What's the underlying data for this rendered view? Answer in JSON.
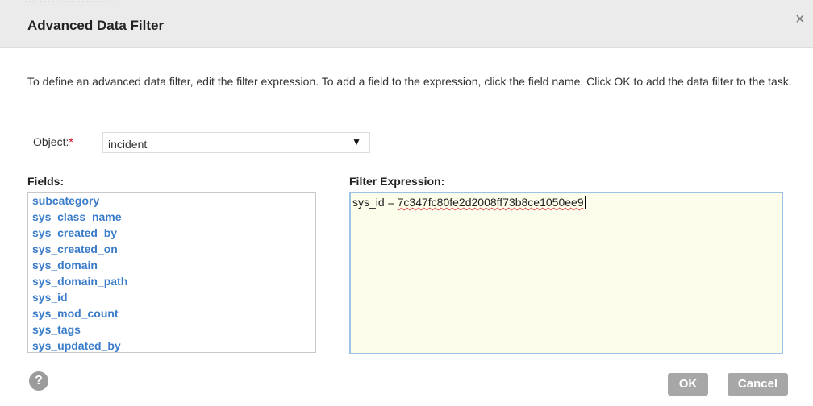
{
  "dialog": {
    "title": "Advanced Data Filter",
    "close_glyph": "×",
    "background_remnant": "··· ········· ··········"
  },
  "description": "To define an advanced data filter, edit the filter expression. To add a field to the expression, click the field name. Click OK to add the data filter to the task.",
  "object": {
    "label": "Object:",
    "required_mark": "*",
    "selected": "incident",
    "arrow_glyph": "▼"
  },
  "fields": {
    "label": "Fields:",
    "items": [
      "subcategory",
      "sys_class_name",
      "sys_created_by",
      "sys_created_on",
      "sys_domain",
      "sys_domain_path",
      "sys_id",
      "sys_mod_count",
      "sys_tags",
      "sys_updated_by"
    ],
    "scroll_up_glyph": "▲",
    "scroll_down_glyph": "▼"
  },
  "filter": {
    "label": "Filter Expression:",
    "prefix": "sys_id = ",
    "value": "7c347fc80fe2d2008ff73b8ce1050ee9"
  },
  "footer": {
    "help_glyph": "?",
    "ok_label": "OK",
    "cancel_label": "Cancel"
  },
  "colors": {
    "field_link": "#3a7cc9",
    "filter_bg": "#fdfdec",
    "filter_border": "#9cc3e4",
    "button_bg": "#a7a7a7",
    "required": "#d0021b"
  },
  "icons": {
    "close": "close-icon",
    "help": "help-icon",
    "dropdown": "chevron-down-icon",
    "scroll_up": "scroll-up-icon",
    "scroll_down": "scroll-down-icon"
  }
}
